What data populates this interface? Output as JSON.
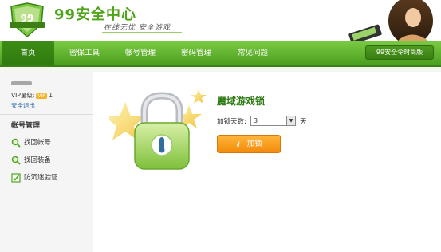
{
  "header": {
    "site_title": "99安全中心",
    "slogan": "在线无忧  安全游戏",
    "hero_badge_text": "99安全中心"
  },
  "nav": {
    "items": [
      "首页",
      "密保工具",
      "帐号管理",
      "密码管理",
      "常见问题"
    ],
    "version_label": "99安全令时尚版"
  },
  "sidebar": {
    "vip_label": "VIP星级:",
    "vip_badge": "VIP",
    "vip_suffix": "1",
    "logout": "安全退出",
    "section_title": "帐号管理",
    "items": [
      {
        "label": "找回帐号",
        "icon": "search-icon"
      },
      {
        "label": "找回装备",
        "icon": "search-icon"
      },
      {
        "label": "防沉迷验证",
        "icon": "check-icon"
      }
    ]
  },
  "main": {
    "title": "魔域游戏锁",
    "days_label": "加锁天数:",
    "days_value": "3",
    "days_unit": "天",
    "lock_button": "加锁"
  },
  "colors": {
    "brand_green": "#4ea51a",
    "nav_green": "#5aab2a",
    "button_orange": "#f6a01f"
  }
}
